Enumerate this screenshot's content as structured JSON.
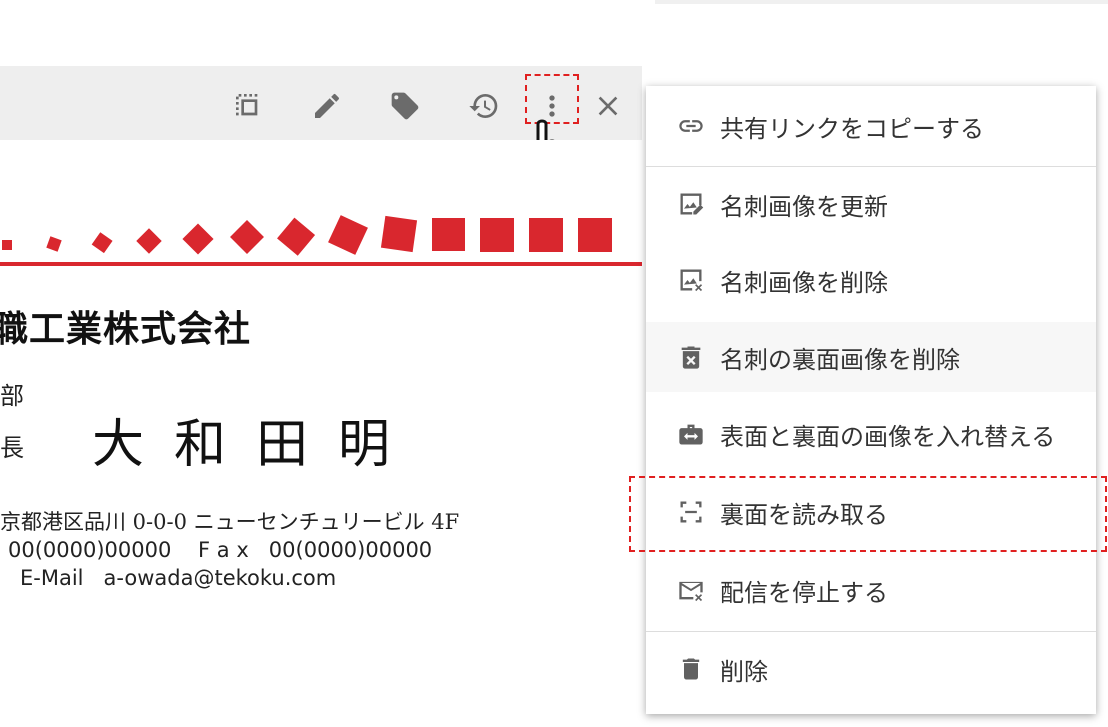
{
  "toolbar": {
    "icons": [
      "crop-icon",
      "edit-icon",
      "tag-icon",
      "history-icon",
      "more-vert-icon",
      "close-icon"
    ]
  },
  "card": {
    "company": "職工業株式会社",
    "department": "部",
    "title": "長",
    "name": "大和田明",
    "address": "京都港区品川 0-0-0 ニューセンチュリービル 4F",
    "tel_fax": "00(0000)00000    F a x   00(0000)00000",
    "email": "E-Mail   a-owada@tekoku.com",
    "accent_color": "#d9272e"
  },
  "menu": {
    "items": [
      {
        "label": "共有リンクをコピーする",
        "icon": "link-icon"
      },
      {
        "label": "名刺画像を更新",
        "icon": "image-edit-icon"
      },
      {
        "label": "名刺画像を削除",
        "icon": "image-remove-icon"
      },
      {
        "label": "名刺の裏面画像を削除",
        "icon": "delete-box-icon"
      },
      {
        "label": "表面と裏面の画像を入れ替える",
        "icon": "swap-icon"
      },
      {
        "label": "裏面を読み取る",
        "icon": "scan-icon"
      },
      {
        "label": "配信を停止する",
        "icon": "mail-off-icon"
      },
      {
        "label": "削除",
        "icon": "trash-icon"
      }
    ]
  },
  "highlight_color": "#e02020"
}
